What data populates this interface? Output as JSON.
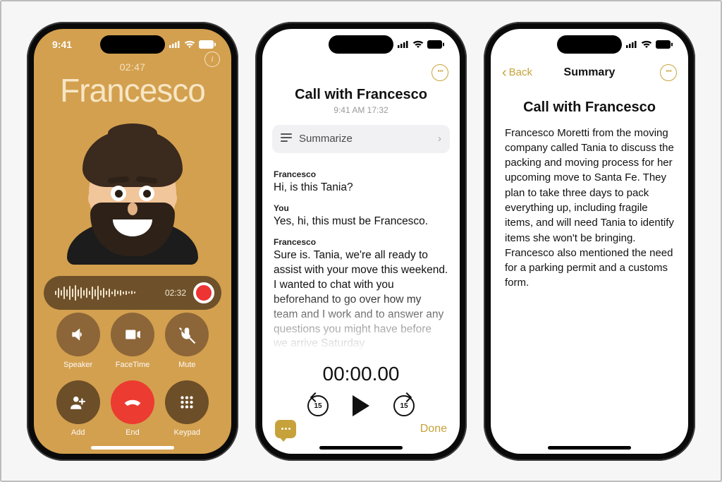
{
  "status": {
    "time": "9:41"
  },
  "phone1": {
    "duration": "02:47",
    "caller": "Francesco",
    "recording_time": "02:32",
    "buttons": {
      "speaker": "Speaker",
      "facetime": "FaceTime",
      "mute": "Mute",
      "add": "Add",
      "end": "End",
      "keypad": "Keypad"
    }
  },
  "phone2": {
    "title": "Call with Francesco",
    "subtitle": "9:41 AM   17:32",
    "summarize_label": "Summarize",
    "skip_seconds": "15",
    "transcript": [
      {
        "speaker": "Francesco",
        "text": "Hi, is this Tania?"
      },
      {
        "speaker": "You",
        "text": "Yes, hi, this must be Francesco."
      },
      {
        "speaker": "Francesco",
        "text": "Sure is. Tania, we're all ready to assist with your move this weekend. I wanted to chat with you beforehand to go over how my team and I work and to answer any questions you might have before we arrive Saturday"
      }
    ],
    "timer": "00:00.00",
    "done": "Done"
  },
  "phone3": {
    "back": "Back",
    "nav_title": "Summary",
    "heading": "Call with Francesco",
    "body": "Francesco Moretti from the moving company called Tania to discuss the packing and moving process for her upcoming move to Santa Fe. They plan to take three days to pack everything up, including fragile items, and will need Tania to identify items she won't be bringing. Francesco also mentioned the need for a parking permit and a customs form."
  }
}
